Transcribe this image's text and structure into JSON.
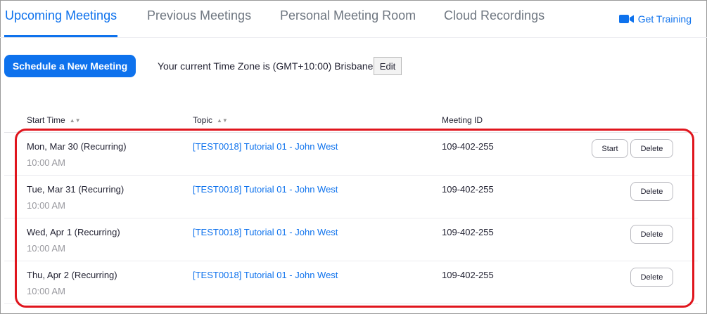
{
  "tabs": [
    {
      "label": "Upcoming Meetings",
      "active": true
    },
    {
      "label": "Previous Meetings",
      "active": false
    },
    {
      "label": "Personal Meeting Room",
      "active": false
    },
    {
      "label": "Cloud Recordings",
      "active": false
    }
  ],
  "get_training": {
    "label": "Get Training",
    "icon": "video-camera-icon"
  },
  "toolbar": {
    "schedule_label": "Schedule a New Meeting",
    "timezone_text": "Your current Time Zone is (GMT+10:00) Brisbane.",
    "edit_label": "Edit"
  },
  "table": {
    "columns": [
      {
        "label": "Start Time",
        "sortable": true
      },
      {
        "label": "Topic",
        "sortable": true
      },
      {
        "label": "Meeting ID",
        "sortable": false
      }
    ],
    "rows": [
      {
        "date": "Mon, Mar 30 (Recurring)",
        "time": "10:00 AM",
        "topic": "[TEST0018] Tutorial 01 - John West",
        "meeting_id": "109-402-255",
        "start_label": "Start",
        "delete_label": "Delete"
      },
      {
        "date": "Tue, Mar 31 (Recurring)",
        "time": "10:00 AM",
        "topic": "[TEST0018] Tutorial 01 - John West",
        "meeting_id": "109-402-255",
        "delete_label": "Delete"
      },
      {
        "date": "Wed, Apr 1 (Recurring)",
        "time": "10:00 AM",
        "topic": "[TEST0018] Tutorial 01 - John West",
        "meeting_id": "109-402-255",
        "delete_label": "Delete"
      },
      {
        "date": "Thu, Apr 2 (Recurring)",
        "time": "10:00 AM",
        "topic": "[TEST0018] Tutorial 01 - John West",
        "meeting_id": "109-402-255",
        "delete_label": "Delete"
      }
    ]
  },
  "colors": {
    "accent": "#0e72ed",
    "highlight": "#e0151d",
    "muted_text": "#98989e"
  }
}
